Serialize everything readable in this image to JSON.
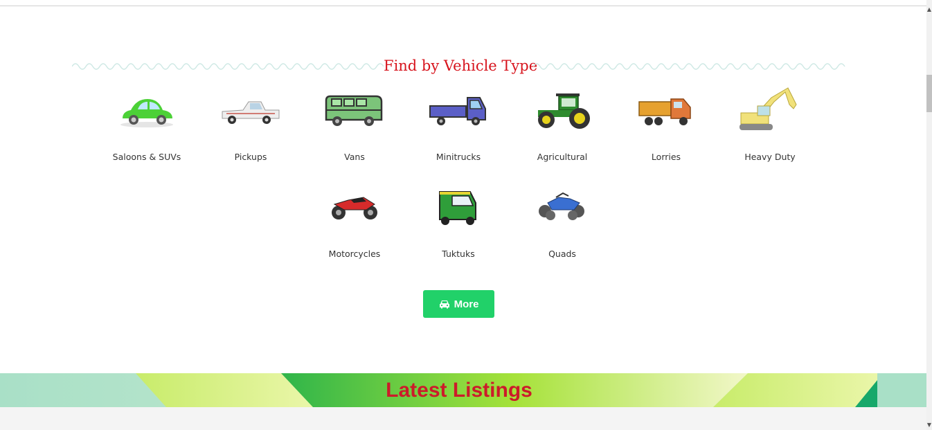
{
  "section": {
    "title": "Find by Vehicle Type"
  },
  "vehicles": [
    {
      "label": "Saloons & SUVs",
      "icon": "car-icon",
      "color": "#4cd137"
    },
    {
      "label": "Pickups",
      "icon": "pickup-truck-icon",
      "color": "#e9e9e9"
    },
    {
      "label": "Vans",
      "icon": "van-icon",
      "color": "#7cc47a"
    },
    {
      "label": "Minitrucks",
      "icon": "minitruck-icon",
      "color": "#5b5fc7"
    },
    {
      "label": "Agricultural",
      "icon": "tractor-icon",
      "color": "#2e8b2e"
    },
    {
      "label": "Lorries",
      "icon": "lorry-icon",
      "color": "#e08a3a"
    },
    {
      "label": "Heavy Duty",
      "icon": "excavator-icon",
      "color": "#f1e17a"
    },
    {
      "label": "Motorcycles",
      "icon": "motorcycle-icon",
      "color": "#d62b2b"
    },
    {
      "label": "Tuktuks",
      "icon": "tuktuk-icon",
      "color": "#2f9e3a"
    },
    {
      "label": "Quads",
      "icon": "quad-bike-icon",
      "color": "#3a6fd1"
    }
  ],
  "more_button": {
    "label": "More",
    "icon": "car-front-icon"
  },
  "banner": {
    "title": "Latest Listings"
  },
  "colors": {
    "accent": "#21d169",
    "title_red": "#d7141d",
    "banner_red": "#cc1b2a"
  }
}
